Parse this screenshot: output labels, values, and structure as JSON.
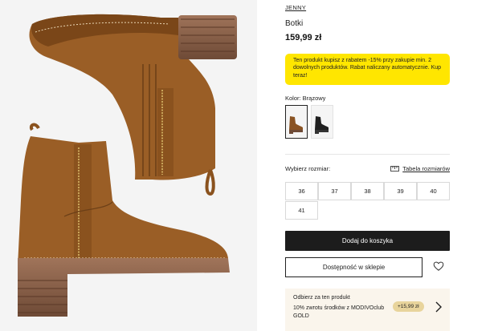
{
  "product": {
    "brand": "JENNY",
    "name": "Botki",
    "price": "159,99 zł"
  },
  "promo": {
    "text": "Ten produkt kupisz z rabatem -15% przy zakupie min. 2 dowolnych produktów. Rabat naliczany automatycznie. Kup teraz!"
  },
  "color": {
    "label": "Kolor: Brązowy",
    "swatches": [
      {
        "name": "Brązowy",
        "hex": "#8a5424",
        "selected": true
      },
      {
        "name": "Czarny",
        "hex": "#1f1f1f",
        "selected": false
      }
    ]
  },
  "size": {
    "label": "Wybierz rozmiar:",
    "chart_link": "Tabela rozmiarów",
    "options": [
      "36",
      "37",
      "38",
      "39",
      "40",
      "41"
    ]
  },
  "actions": {
    "add_to_cart": "Dodaj do koszyka",
    "store_availability": "Dostępność w sklepie",
    "wishlist_icon": "heart-icon"
  },
  "club": {
    "title": "Odbierz za ten produkt",
    "description": "10% zwrotu środków z MODIVOclub GOLD",
    "badge": "+15,99 zł"
  },
  "colors": {
    "accent_yellow": "#ffe600",
    "button_dark": "#1c1c1c",
    "club_bg": "#faf5ec",
    "badge_gold": "#e8d49c",
    "boot_brown": "#9a5e26"
  }
}
